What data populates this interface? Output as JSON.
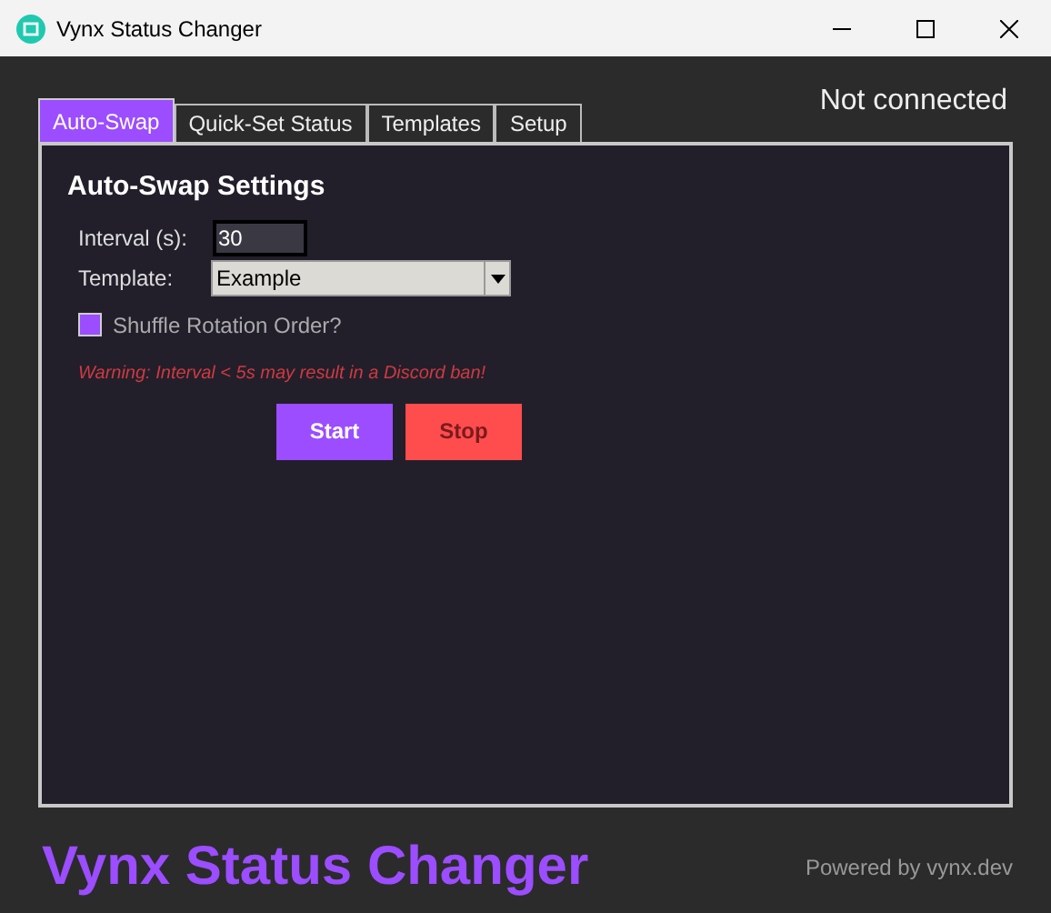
{
  "window": {
    "title": "Vynx Status Changer"
  },
  "connection_status": "Not connected",
  "tabs": [
    {
      "label": "Auto-Swap",
      "selected": true
    },
    {
      "label": "Quick-Set Status",
      "selected": false
    },
    {
      "label": "Templates",
      "selected": false
    },
    {
      "label": "Setup",
      "selected": false
    }
  ],
  "panel": {
    "heading": "Auto-Swap Settings",
    "interval": {
      "label": "Interval (s):",
      "value": "30"
    },
    "template": {
      "label": "Template:",
      "value": "Example"
    },
    "shuffle": {
      "label": "Shuffle Rotation Order?",
      "checked": true
    },
    "warning": "Warning: Interval < 5s may result in a Discord ban!",
    "buttons": [
      {
        "label": "Start",
        "kind": "start",
        "disabled": false
      },
      {
        "label": "Stop",
        "kind": "stop",
        "disabled": true
      }
    ]
  },
  "footer": {
    "title": "Vynx Status Changer",
    "credit": "Powered by vynx.dev"
  }
}
